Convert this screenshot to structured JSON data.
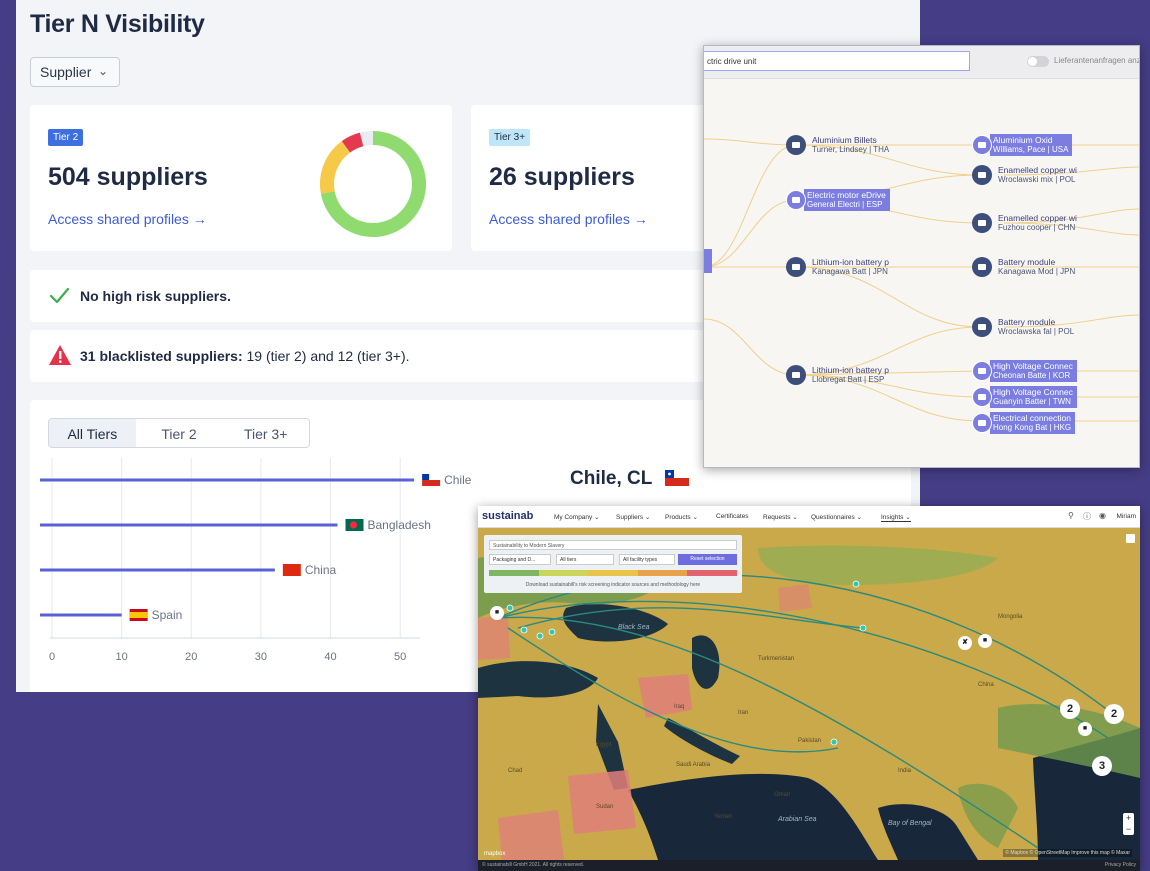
{
  "dashboard": {
    "title": "Tier N Visibility",
    "dropdown": "Supplier",
    "tiers": [
      {
        "badge": "Tier 2",
        "count": "504 suppliers",
        "link": "Access shared profiles →",
        "donut": {
          "green": 0.72,
          "yellow": 0.18,
          "red": 0.06,
          "grey": 0.04
        }
      },
      {
        "badge": "Tier 3+",
        "count": "26 suppliers",
        "link": "Access shared profiles →"
      }
    ],
    "risk_text": "No high risk suppliers.",
    "blacklist_bold": "31 blacklisted suppliers:",
    "blacklist_rest": " 19 (tier 2) and 12 (tier 3+).",
    "tabs": [
      "All Tiers",
      "Tier 2",
      "Tier 3+"
    ],
    "active_tab": "All Tiers",
    "detail_title": "Chile, CL",
    "colors": {
      "accent": "#5a61d6",
      "green": "#8fdb6f",
      "yellow": "#f7c948",
      "red": "#e53950",
      "link": "#3d5bd8"
    }
  },
  "chart_data": {
    "type": "bar",
    "orientation": "horizontal",
    "categories": [
      "Chile",
      "Bangladesh",
      "China",
      "Spain"
    ],
    "values": [
      52,
      41,
      32,
      10
    ],
    "xlim": [
      0,
      55
    ],
    "xticks": [
      0,
      10,
      20,
      30,
      40,
      50
    ],
    "color": "#5a61d6"
  },
  "graph": {
    "search_value": "ctric drive unit",
    "toggle_label": "Lieferantenanfragen anze",
    "nodes": [
      {
        "name": "Aluminium Billets",
        "sub": "Turner, Lindsey | THA",
        "hl": false
      },
      {
        "name": "Electric motor eDrive",
        "sub": "General Electri | ESP",
        "hl": true
      },
      {
        "name": "Lithium-ion battery p",
        "sub": "Kanagawa Batt | JPN",
        "hl": false
      },
      {
        "name": "Lithium-ion battery p",
        "sub": "Llobregat Batt | ESP",
        "hl": false
      },
      {
        "name": "Aluminium Oxid",
        "sub": "Williams, Pace | USA",
        "hl": true
      },
      {
        "name": "Enamelled copper wi",
        "sub": "Wroclawski mix | POL",
        "hl": false
      },
      {
        "name": "Enamelled copper wi",
        "sub": "Fuzhou cooper | CHN",
        "hl": false
      },
      {
        "name": "Battery module",
        "sub": "Kanagawa Mod | JPN",
        "hl": false
      },
      {
        "name": "Battery module",
        "sub": "Wroclawska fal | POL",
        "hl": false
      },
      {
        "name": "High Voltage Connec",
        "sub": "Cheonan Batte | KOR",
        "hl": true
      },
      {
        "name": "High Voltage Connec",
        "sub": "Guanyin Batter | TWN",
        "hl": true
      },
      {
        "name": "Electrical connection",
        "sub": "Hong Kong Bat | HKG",
        "hl": true
      }
    ]
  },
  "map": {
    "brand": "sustainab",
    "nav": [
      "My Company ⌄",
      "Suppliers ⌄",
      "Products ⌄",
      "Certificates",
      "Requests ⌄",
      "Questionnaires ⌄",
      "Insights ⌄"
    ],
    "active_nav": "Insights ⌄",
    "user": "Miriam",
    "filter_search": "Sustainability to Modern Slavery",
    "filters": [
      "Packaging and D...",
      "All tiers",
      "All facility types"
    ],
    "reset": "Reset selection",
    "scale_colors": [
      "#7fb563",
      "#c9d65a",
      "#e9c44b",
      "#e8a24a",
      "#e0636d"
    ],
    "download": "Download sustainabill's risk screening indicator sources and methodology here",
    "clusters": [
      "2",
      "2",
      "3"
    ],
    "labels": [
      "Black Sea",
      "Arabian Sea",
      "Bay of Bengal",
      "Turkmenistan",
      "Saudi Arabia",
      "Egypt",
      "Sudan",
      "Pakistan",
      "India",
      "China",
      "Iran",
      "Mongolia",
      "Chad",
      "Oman",
      "Yemen",
      "Iraq"
    ],
    "mapbox": "mapbox",
    "attribution": "© Mapbox © OpenStreetMap Improve this map © Maxar",
    "footer_left": "© sustainabill GmbH 2021. All rights reserved.",
    "footer_right": "Privacy Policy"
  }
}
